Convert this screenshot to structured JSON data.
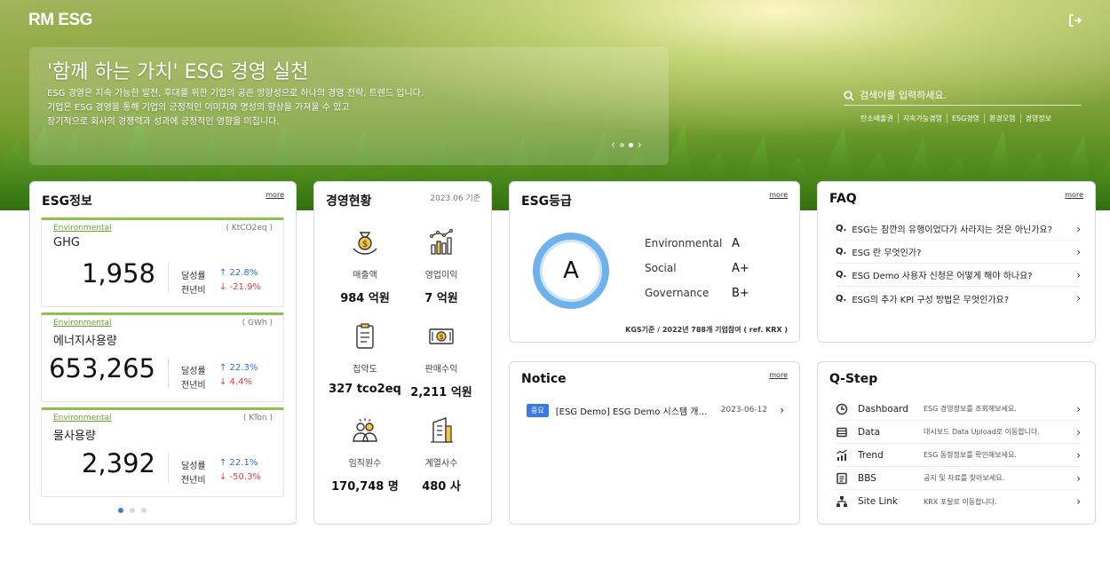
{
  "brand": {
    "logo": "RM ESG"
  },
  "hero": {
    "title": "'함께 하는 가치' ESG 경영 실천",
    "desc": [
      "ESG 경영은 지속 가능한 발전, 후대를 위한 기업의 공존 방향성으로 하나의 경영 전략, 트렌드 입니다.",
      "기업은 ESG 경영을 통해 기업의 긍정적인 이미지와 명성의 향상을 가져올 수 있고",
      "장기적으로 회사의 경쟁력과 성과에 긍정적인 영향을 미칩니다."
    ],
    "search_placeholder": "검색어를 입력하세요.",
    "tags": [
      "탄소배출권",
      "지속가능경영",
      "ESG경영",
      "환경오염",
      "경영정보"
    ]
  },
  "esg_info": {
    "title": "ESG정보",
    "more": "more",
    "rate_label": "달성률",
    "yoy_label": "전년비",
    "items": [
      {
        "category": "Environmental",
        "unit": "( KtCO2eq )",
        "name": "GHG",
        "value": "1,958",
        "rate": "↑ 22.8%",
        "yoy": "↓ -21.9%"
      },
      {
        "category": "Environmental",
        "unit": "( GWh )",
        "name": "에너지사용량",
        "value": "653,265",
        "rate": "↑ 22.3%",
        "yoy": "↓ 4.4%"
      },
      {
        "category": "Environmental",
        "unit": "( KTon )",
        "name": "물사용량",
        "value": "2,392",
        "rate": "↑ 22.1%",
        "yoy": "↓ -50.3%"
      }
    ]
  },
  "management": {
    "title": "경영현황",
    "basis": "2023.06 기준",
    "items": [
      {
        "label": "매출액",
        "value": "984 억원",
        "icon": "money-bag-icon"
      },
      {
        "label": "영업이익",
        "value": "7 억원",
        "icon": "bar-chart-icon"
      },
      {
        "label": "집약도",
        "value": "327 tco2eq",
        "icon": "clipboard-icon"
      },
      {
        "label": "판매수익",
        "value": "2,211 억원",
        "icon": "banknote-icon"
      },
      {
        "label": "임직원수",
        "value": "170,748 명",
        "icon": "people-icon"
      },
      {
        "label": "계열사수",
        "value": "480 사",
        "icon": "building-icon"
      }
    ]
  },
  "grade": {
    "title": "ESG등급",
    "more": "more",
    "overall": "A",
    "rows": [
      {
        "label": "Environmental",
        "value": "A"
      },
      {
        "label": "Social",
        "value": "A+"
      },
      {
        "label": "Governance",
        "value": "B+"
      }
    ],
    "note": "KGS기준 / 2022년 788개 기업참여 ( ref. KRX )"
  },
  "faq": {
    "title": "FAQ",
    "more": "more",
    "q": "Q.",
    "items": [
      "ESG는 잠깐의 유행이었다가 사라지는 것은 아닌가요?",
      "ESG 란 무엇인가?",
      "ESG Demo 사용자 신청은 어떻게 해야 하나요?",
      "ESG의 추가 KPI 구성 방법은 무엇인가요?"
    ]
  },
  "notice": {
    "title": "Notice",
    "more": "more",
    "items": [
      {
        "badge": "중요",
        "text": "[ESG Demo] ESG Demo 시스템 개편 안내",
        "date": "2023-06-12"
      }
    ]
  },
  "qstep": {
    "title": "Q-Step",
    "items": [
      {
        "label": "Dashboard",
        "desc": "ESG 경영정보를 조회해보세요.",
        "icon": "clock-icon"
      },
      {
        "label": "Data",
        "desc": "대시보드 Data Upload로 이동합니다.",
        "icon": "database-icon"
      },
      {
        "label": "Trend",
        "desc": "ESG 동향정보를 확인해보세요.",
        "icon": "trend-icon"
      },
      {
        "label": "BBS",
        "desc": "공지 및 자료를 찾아보세요.",
        "icon": "board-icon"
      },
      {
        "label": "Site Link",
        "desc": "KRX 포탈로 이동합니다.",
        "icon": "sitemap-icon"
      }
    ]
  },
  "colors": {
    "accent": "#3b7be0",
    "up": "#2f6fd0",
    "down": "#e03c3c",
    "env": "#8bc34a",
    "ring": "#6fb1ea"
  }
}
